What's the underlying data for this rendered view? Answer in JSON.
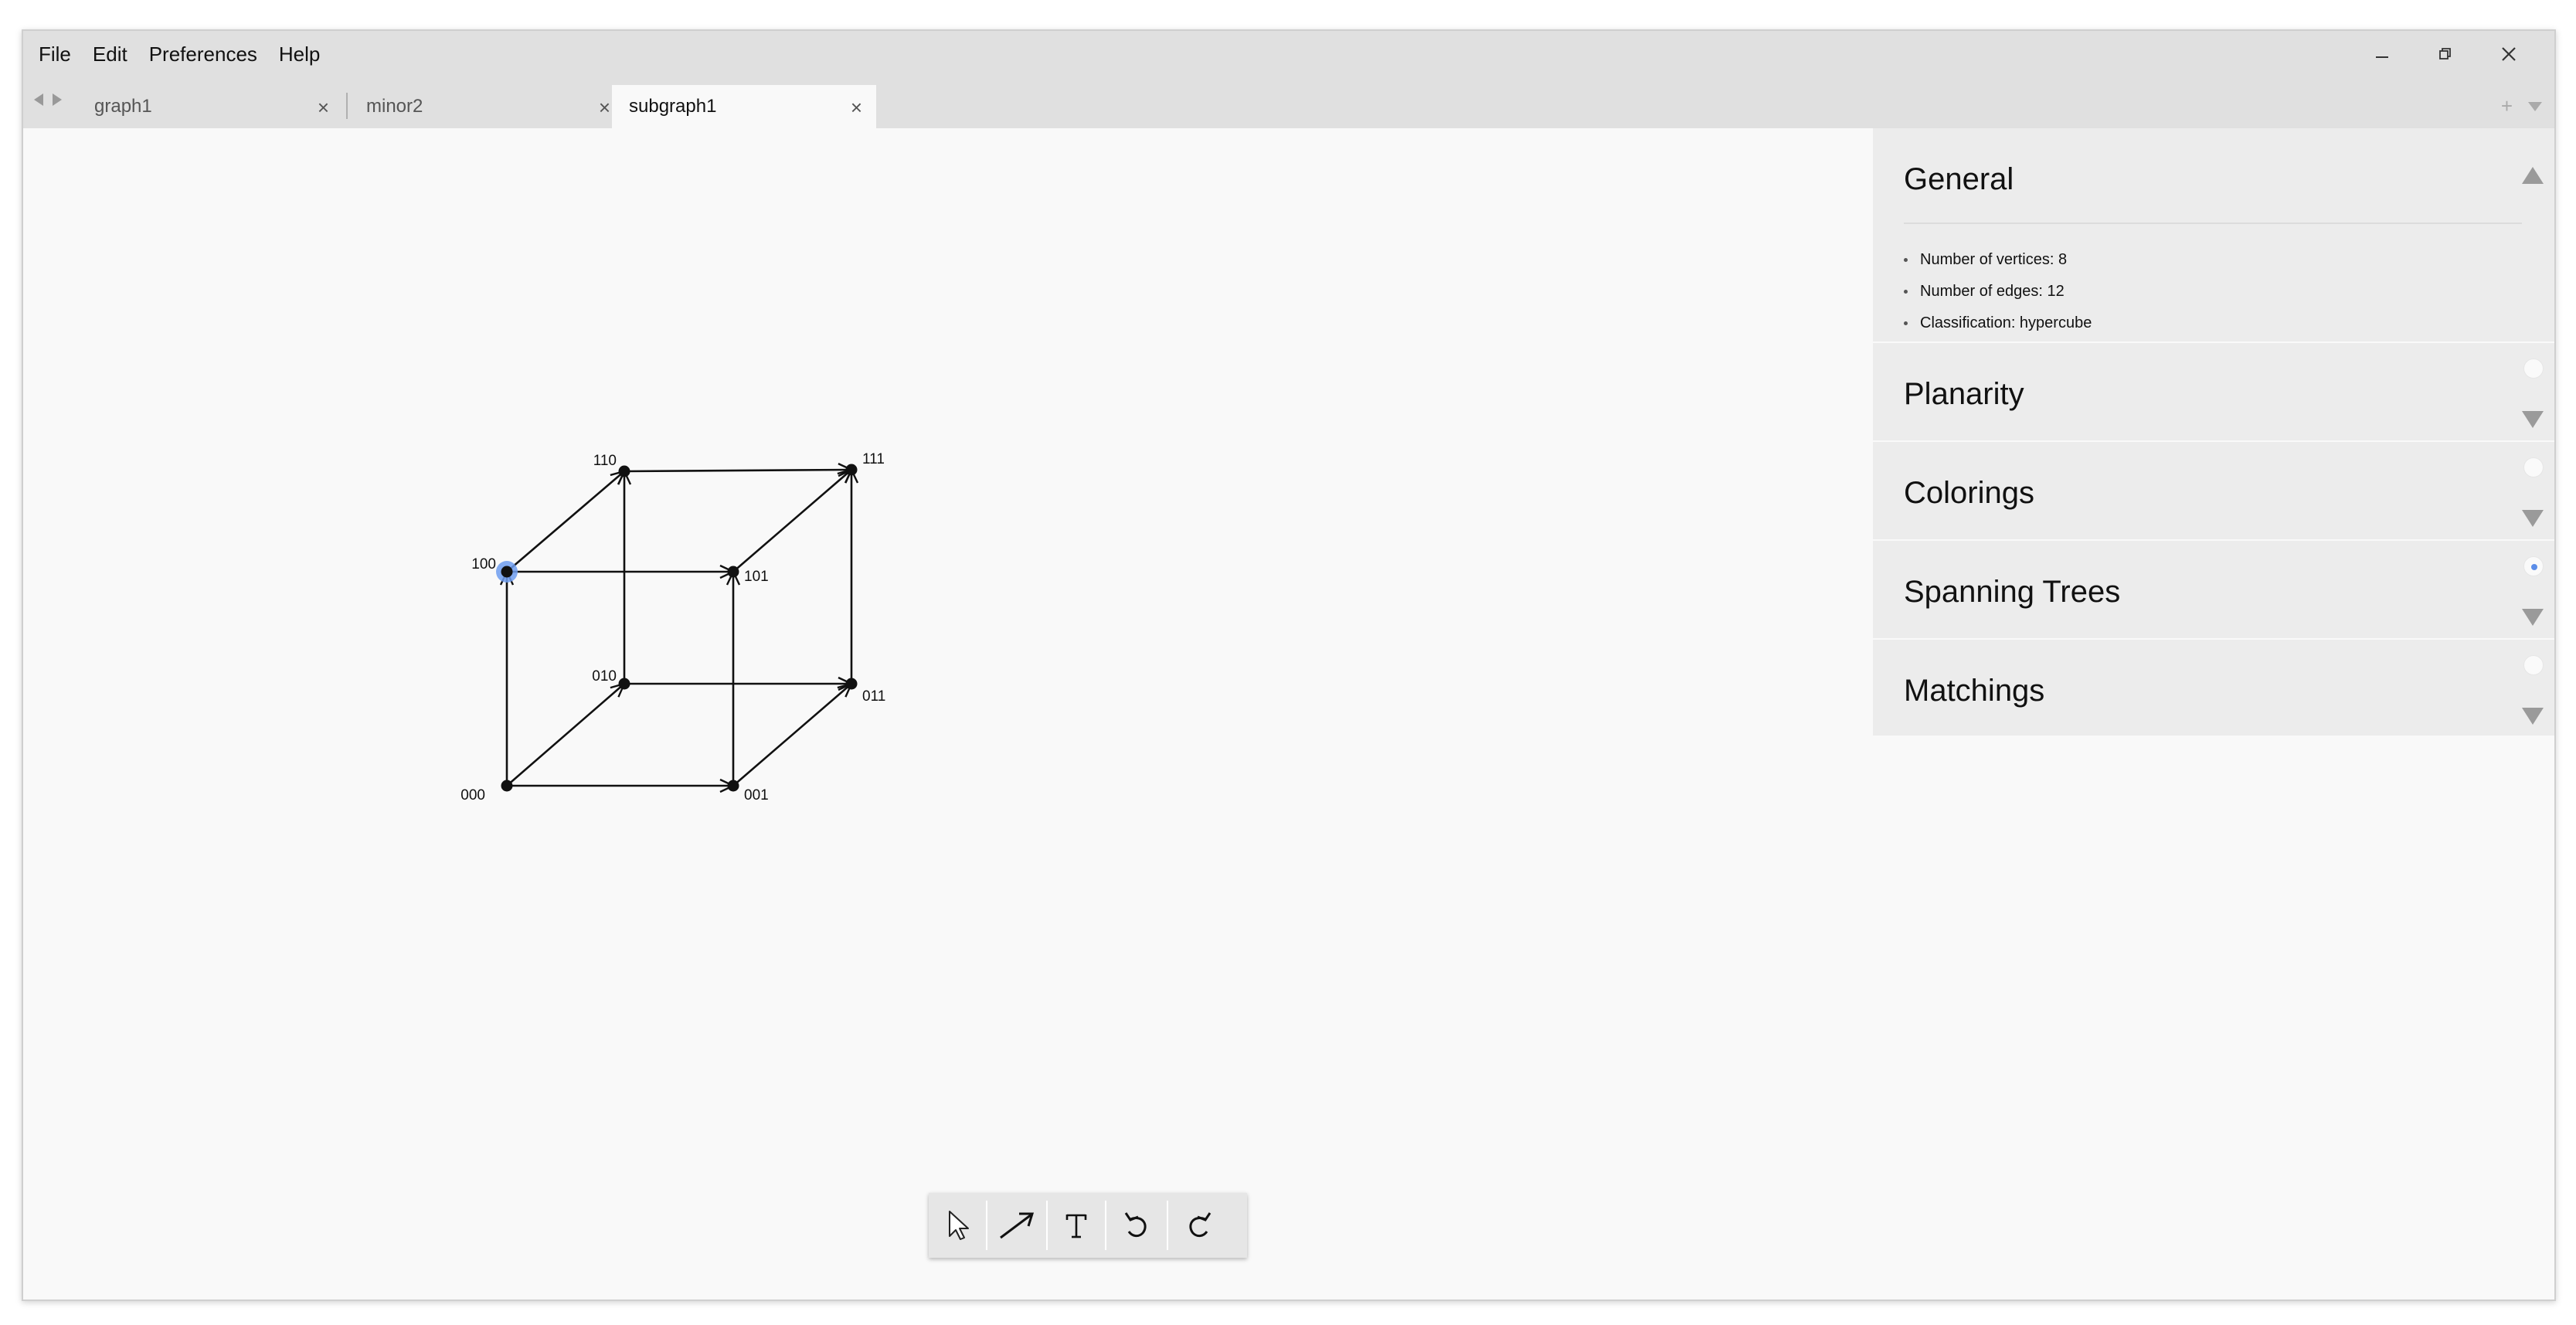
{
  "menu": {
    "file": "File",
    "edit": "Edit",
    "preferences": "Preferences",
    "help": "Help"
  },
  "window_controls": {
    "minimize_icon": "minimize-icon",
    "restore_icon": "restore-icon",
    "close_icon": "close-icon"
  },
  "tabs": [
    {
      "label": "graph1",
      "active": false
    },
    {
      "label": "minor2",
      "active": false
    },
    {
      "label": "subgraph1",
      "active": true
    }
  ],
  "tab_strip": {
    "add_icon": "plus-icon",
    "menu_icon": "chevron-down-icon",
    "prev_icon": "left-arrow-icon",
    "next_icon": "right-arrow-icon"
  },
  "graph": {
    "vertices": [
      {
        "label": "000",
        "selected": false
      },
      {
        "label": "001",
        "selected": false
      },
      {
        "label": "010",
        "selected": false
      },
      {
        "label": "011",
        "selected": false
      },
      {
        "label": "100",
        "selected": true
      },
      {
        "label": "101",
        "selected": false
      },
      {
        "label": "110",
        "selected": false
      },
      {
        "label": "111",
        "selected": false
      }
    ],
    "edges": [
      {
        "from": "000",
        "to": "001"
      },
      {
        "from": "000",
        "to": "010"
      },
      {
        "from": "000",
        "to": "100"
      },
      {
        "from": "001",
        "to": "011"
      },
      {
        "from": "001",
        "to": "101"
      },
      {
        "from": "010",
        "to": "011"
      },
      {
        "from": "010",
        "to": "110"
      },
      {
        "from": "011",
        "to": "111"
      },
      {
        "from": "100",
        "to": "101"
      },
      {
        "from": "100",
        "to": "110"
      },
      {
        "from": "101",
        "to": "111"
      },
      {
        "from": "110",
        "to": "111"
      }
    ],
    "directed": true,
    "selection_color": "#6f9df0"
  },
  "panel": {
    "general": {
      "title": "General",
      "expanded": true,
      "stats": [
        "Number of vertices: 8",
        "Number of edges: 12",
        "Classification: hypercube"
      ]
    },
    "sections": [
      {
        "title": "Planarity",
        "active": false
      },
      {
        "title": "Colorings",
        "active": false
      },
      {
        "title": "Spanning Trees",
        "active": true
      },
      {
        "title": "Matchings",
        "active": false
      }
    ]
  },
  "toolbar": {
    "tools": [
      {
        "icon": "pointer-icon",
        "name": "select-tool"
      },
      {
        "icon": "arrow-icon",
        "name": "edge-tool"
      },
      {
        "icon": "text-icon",
        "name": "text-tool"
      },
      {
        "icon": "undo-icon",
        "name": "undo-button"
      },
      {
        "icon": "redo-icon",
        "name": "redo-button"
      }
    ]
  }
}
